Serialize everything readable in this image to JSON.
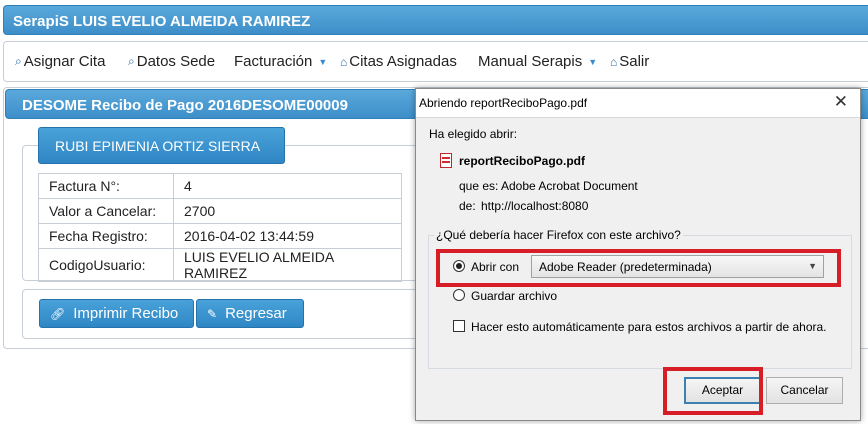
{
  "app": {
    "title": "SerapiS LUIS EVELIO ALMEIDA RAMIREZ",
    "accent": "#3d8ec9"
  },
  "menu": [
    {
      "label": "Asignar Cita",
      "icon": "search-icon"
    },
    {
      "label": "Datos Sede",
      "icon": "search-icon"
    },
    {
      "label": "Facturación",
      "dropdown": true
    },
    {
      "label": "Citas Asignadas",
      "icon": "home-icon"
    },
    {
      "label": "Manual Serapis",
      "dropdown": true
    },
    {
      "label": "Salir",
      "icon": "home-icon"
    }
  ],
  "panel": {
    "title": "DESOME Recibo de Pago 2016DESOME00009",
    "person": "RUBI EPIMENIA ORTIZ SIERRA",
    "rows": [
      {
        "key": "Factura N°:",
        "value": "4"
      },
      {
        "key": "Valor a Cancelar:",
        "value": "2700"
      },
      {
        "key": "Fecha Registro:",
        "value": "2016-04-02 13:44:59"
      },
      {
        "key": "CodigoUsuario:",
        "value": "LUIS EVELIO ALMEIDA RAMIREZ"
      }
    ],
    "print_button": "Imprimir Recibo",
    "back_button": "Regresar"
  },
  "dialog": {
    "title": "Abriendo reportReciboPago.pdf",
    "close": "✕",
    "chosen_label": "Ha elegido abrir:",
    "filename": "reportReciboPago.pdf",
    "type_label": "que es:",
    "type_value": "Adobe Acrobat Document",
    "from_label": "de:",
    "from_value": "http://localhost:8080",
    "question": "¿Qué debería hacer Firefox con este archivo?",
    "open_with_label": "Abrir con",
    "open_with_value": "Adobe Reader  (predeterminada)",
    "save_label": "Guardar archivo",
    "auto_label": "Hacer esto automáticamente para estos archivos a partir de ahora.",
    "accept": "Aceptar",
    "cancel": "Cancelar",
    "highlight_color": "#d71d26"
  }
}
